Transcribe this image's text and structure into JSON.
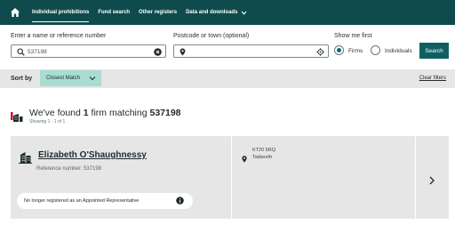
{
  "nav": {
    "items": [
      {
        "label": "Individual prohibitions"
      },
      {
        "label": "Fund search"
      },
      {
        "label": "Other registers"
      },
      {
        "label": "Data and downloads"
      }
    ]
  },
  "search": {
    "name_label": "Enter a name or reference number",
    "name_value": "537198",
    "postcode_label": "Postcode or town (optional)",
    "postcode_value": "",
    "show_label": "Show me first",
    "option_firms": "Firms",
    "option_individuals": "Individuals",
    "selected_option": "Firms",
    "button_label": "Search"
  },
  "sort": {
    "label": "Sort by",
    "selected": "Closest Match",
    "clear_label": "Clear filters"
  },
  "results": {
    "found_prefix": "We've found",
    "count": "1",
    "found_middle": "firm matching",
    "query": "537198",
    "showing": "Showing 1 - 1 of 1"
  },
  "card": {
    "name": "Elizabeth O'Shaughnessy",
    "reference": "Reference number: 537198",
    "status": "No longer registered as an Appointed Representative",
    "postcode": "KT20 5RQ",
    "town": "Tadworth"
  },
  "colors": {
    "nav_bg": "#0f4b4d",
    "accent": "#0f5f62",
    "sort_select": "#a9dcd2",
    "panel_grey": "#e6e6e6",
    "brand_red": "#c8102e"
  },
  "icons": [
    "home-icon",
    "chevron-down-icon",
    "search-icon",
    "clear-icon",
    "location-pin-icon",
    "locate-icon",
    "firm-results-icon",
    "building-icon",
    "info-icon",
    "chevron-right-icon"
  ]
}
